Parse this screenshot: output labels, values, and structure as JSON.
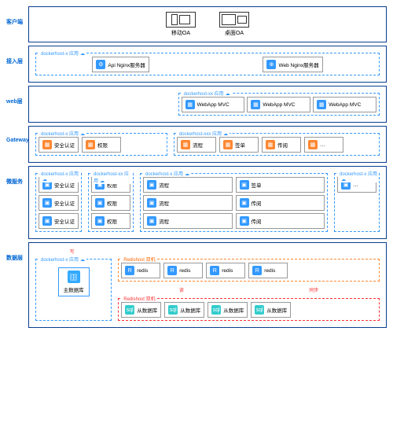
{
  "layers": {
    "client": "客户端",
    "access": "接入层",
    "web": "web层",
    "gateway": "Gateway",
    "service": "微服务",
    "data": "数据层"
  },
  "clients": {
    "mobile": "移动OA",
    "desktop": "桌面OA"
  },
  "access": {
    "box_title": "dockerhost-x 应用",
    "api_nginx": "Api Nginx服务器",
    "web_nginx": "Web Nginx服务器"
  },
  "web": {
    "box_title": "dockerhost-xx 应用",
    "webapp": "WebApp MVC"
  },
  "gateway": {
    "left_title": "dockerhost-x 应用",
    "right_title": "dockerhost-xxx 应用",
    "items": {
      "auth": "安全认证",
      "perm": "权限",
      "flow": "流程",
      "sign": "签单",
      "pass": "传阅",
      "more": "…"
    }
  },
  "service": {
    "box1": "dockerhost-x 应用",
    "box2": "dockerhost-xx 应用",
    "box3": "dockerhost-x 应用",
    "box4": "dockerhost-x 应用",
    "auth": "安全认证",
    "perm": "权限",
    "flow": "流程",
    "sign": "签单",
    "pass": "传阅",
    "more": "…"
  },
  "data": {
    "write": "写",
    "read": "读",
    "sync": "同步",
    "master_box": "dockerhost-x 应用",
    "redis_master": "Redishost 双机",
    "redis_slave": "Redishost 双机",
    "master_db": "主数据库",
    "slave_db": "从数据库",
    "redis": "redis"
  }
}
